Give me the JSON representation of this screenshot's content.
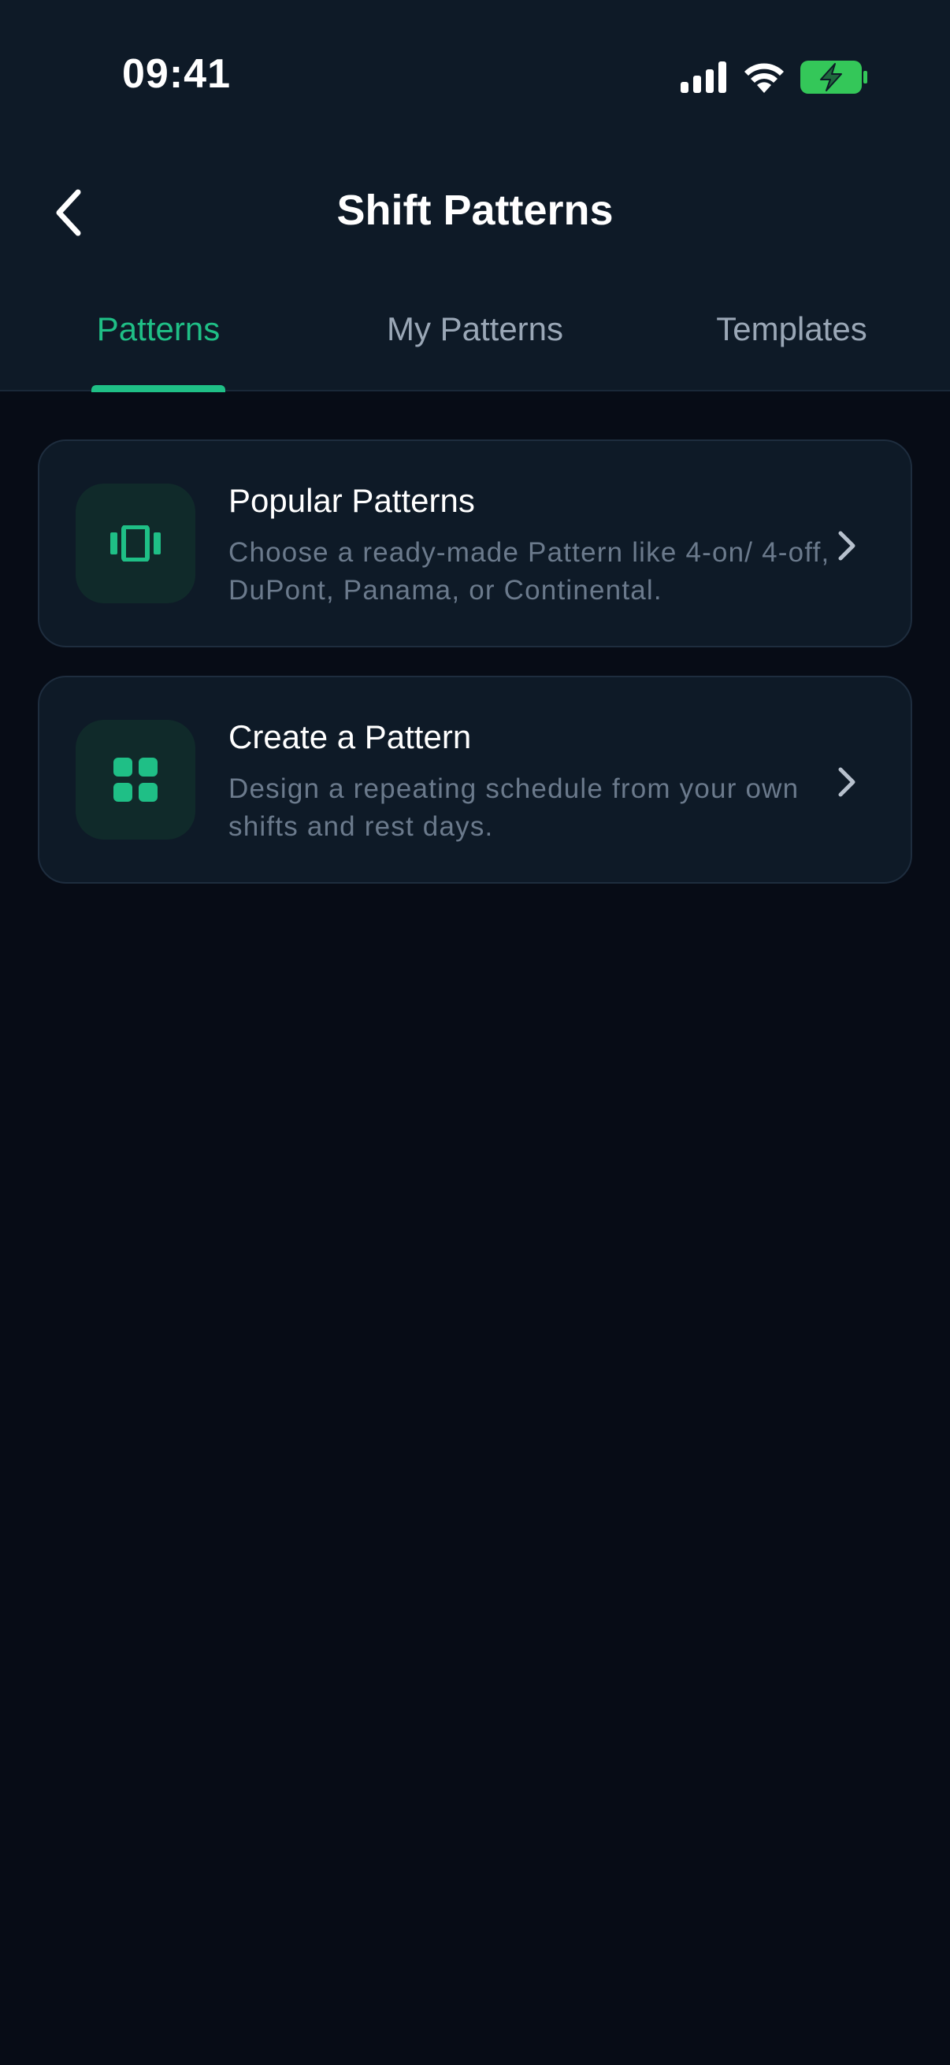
{
  "status_bar": {
    "time": "09:41",
    "signal_icon": "cellular-signal-icon",
    "wifi_icon": "wifi-icon",
    "battery_icon": "battery-charging-icon"
  },
  "header": {
    "title": "Shift Patterns",
    "back_icon": "chevron-left-icon"
  },
  "tabs": [
    {
      "label": "Patterns",
      "active": true
    },
    {
      "label": "My Patterns",
      "active": false
    },
    {
      "label": "Templates",
      "active": false
    }
  ],
  "cards": [
    {
      "title": "Popular Patterns",
      "description": "Choose a ready-made Pattern like 4-on/ 4-off, DuPont, Panama, or Continental.",
      "icon": "carousel-icon"
    },
    {
      "title": "Create a Pattern",
      "description": "Design a repeating schedule from your own shifts and rest days.",
      "icon": "grid-icon"
    }
  ],
  "colors": {
    "accent": "#1fbf86",
    "background": "#070c16",
    "surface": "#0e1a27",
    "muted_text": "#6b7a8c",
    "tab_text": "#9aa7b6",
    "battery": "#34c759"
  }
}
